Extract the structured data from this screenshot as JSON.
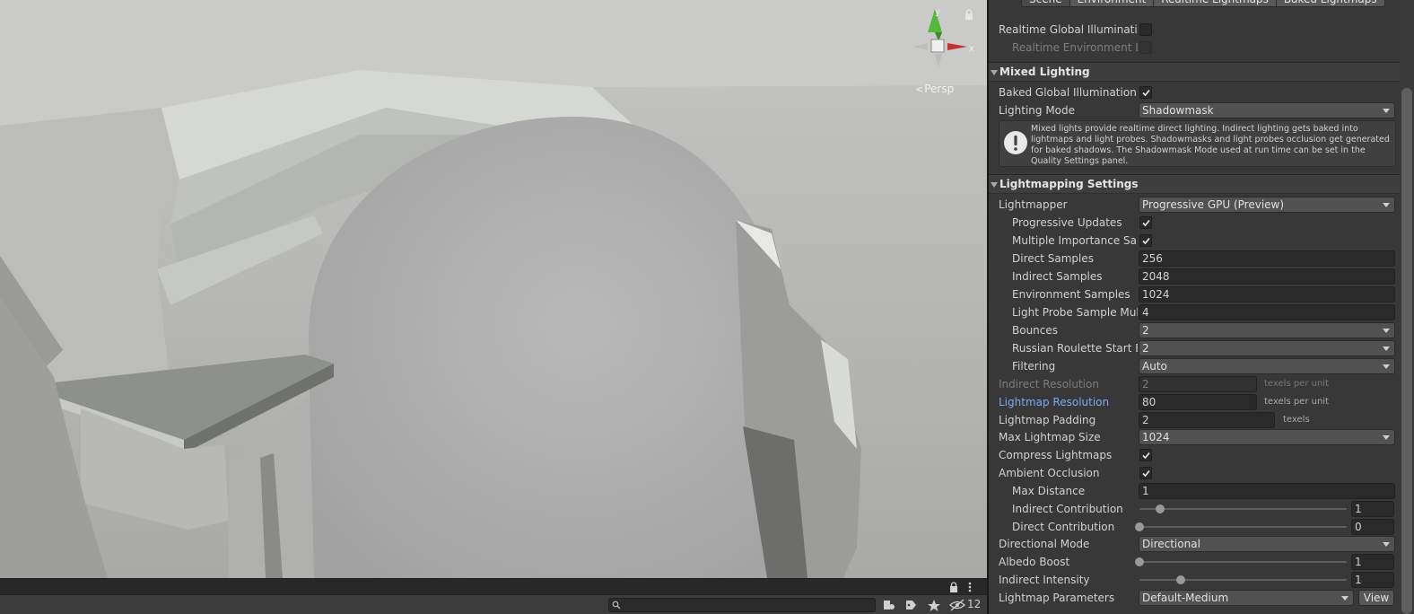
{
  "scene_view": {
    "projection_label": "Persp",
    "gizmo": {
      "y_axis": "y",
      "x_axis": "x"
    },
    "search": {
      "value": "",
      "placeholder": ""
    },
    "hidden_count": "12"
  },
  "lighting": {
    "tabs": [
      {
        "label": "Scene",
        "active": true
      },
      {
        "label": "Environment",
        "active": false
      },
      {
        "label": "Realtime Lightmaps",
        "active": false
      },
      {
        "label": "Baked Lightmaps",
        "active": false
      }
    ],
    "realtime_gi": {
      "label": "Realtime Global Illumination",
      "checked": false
    },
    "realtime_env": {
      "label": "Realtime Environment Lighting",
      "checked": false
    },
    "mixed": {
      "title": "Mixed Lighting",
      "baked_gi": {
        "label": "Baked Global Illumination",
        "checked": true
      },
      "lighting_mode": {
        "label": "Lighting Mode",
        "value": "Shadowmask"
      },
      "help": "Mixed lights provide realtime direct lighting. Indirect lighting gets baked into lightmaps and light probes. Shadowmasks and light probes occlusion get generated for baked shadows. The Shadowmask Mode used at run time can be set in the Quality Settings panel."
    },
    "lightmapping": {
      "title": "Lightmapping Settings",
      "lightmapper": {
        "label": "Lightmapper",
        "value": "Progressive GPU (Preview)"
      },
      "progressive_updates": {
        "label": "Progressive Updates",
        "checked": true
      },
      "multiple_importance": {
        "label": "Multiple Importance Sampling",
        "checked": true
      },
      "direct_samples": {
        "label": "Direct Samples",
        "value": "256"
      },
      "indirect_samples": {
        "label": "Indirect Samples",
        "value": "2048"
      },
      "environment_samples": {
        "label": "Environment Samples",
        "value": "1024"
      },
      "light_probe_mult": {
        "label": "Light Probe Sample Multiplier",
        "value": "4"
      },
      "bounces": {
        "label": "Bounces",
        "value": "2"
      },
      "russian_roulette": {
        "label": "Russian Roulette Start Bounce",
        "value": "2"
      },
      "filtering": {
        "label": "Filtering",
        "value": "Auto"
      },
      "indirect_resolution": {
        "label": "Indirect Resolution",
        "value": "2",
        "unit": "texels per unit"
      },
      "lightmap_resolution": {
        "label": "Lightmap Resolution",
        "value": "80",
        "unit": "texels per unit"
      },
      "lightmap_padding": {
        "label": "Lightmap Padding",
        "value": "2",
        "unit": "texels"
      },
      "max_lightmap_size": {
        "label": "Max Lightmap Size",
        "value": "1024"
      },
      "compress": {
        "label": "Compress Lightmaps",
        "checked": true
      },
      "ambient_occlusion": {
        "label": "Ambient Occlusion",
        "checked": true
      },
      "max_distance": {
        "label": "Max Distance",
        "value": "1"
      },
      "indirect_contribution": {
        "label": "Indirect Contribution",
        "value": "1",
        "level": 0.1
      },
      "direct_contribution": {
        "label": "Direct Contribution",
        "value": "0",
        "level": 0.0
      },
      "directional_mode": {
        "label": "Directional Mode",
        "value": "Directional"
      },
      "albedo_boost": {
        "label": "Albedo Boost",
        "value": "1",
        "level": 0.0
      },
      "indirect_intensity": {
        "label": "Indirect Intensity",
        "value": "1",
        "level": 0.2
      },
      "lightmap_parameters": {
        "label": "Lightmap Parameters",
        "value": "Default-Medium",
        "button": "View"
      }
    }
  },
  "colors": {
    "accent_blue": "#7babf5",
    "panel_bg": "#383838",
    "field_bg": "#2a2a2a"
  },
  "icons": [
    "lock-icon",
    "gizmo-icon",
    "search-icon",
    "info-icon",
    "check-icon",
    "tag-icon",
    "star-icon",
    "visibility-icon",
    "menu-icon"
  ]
}
